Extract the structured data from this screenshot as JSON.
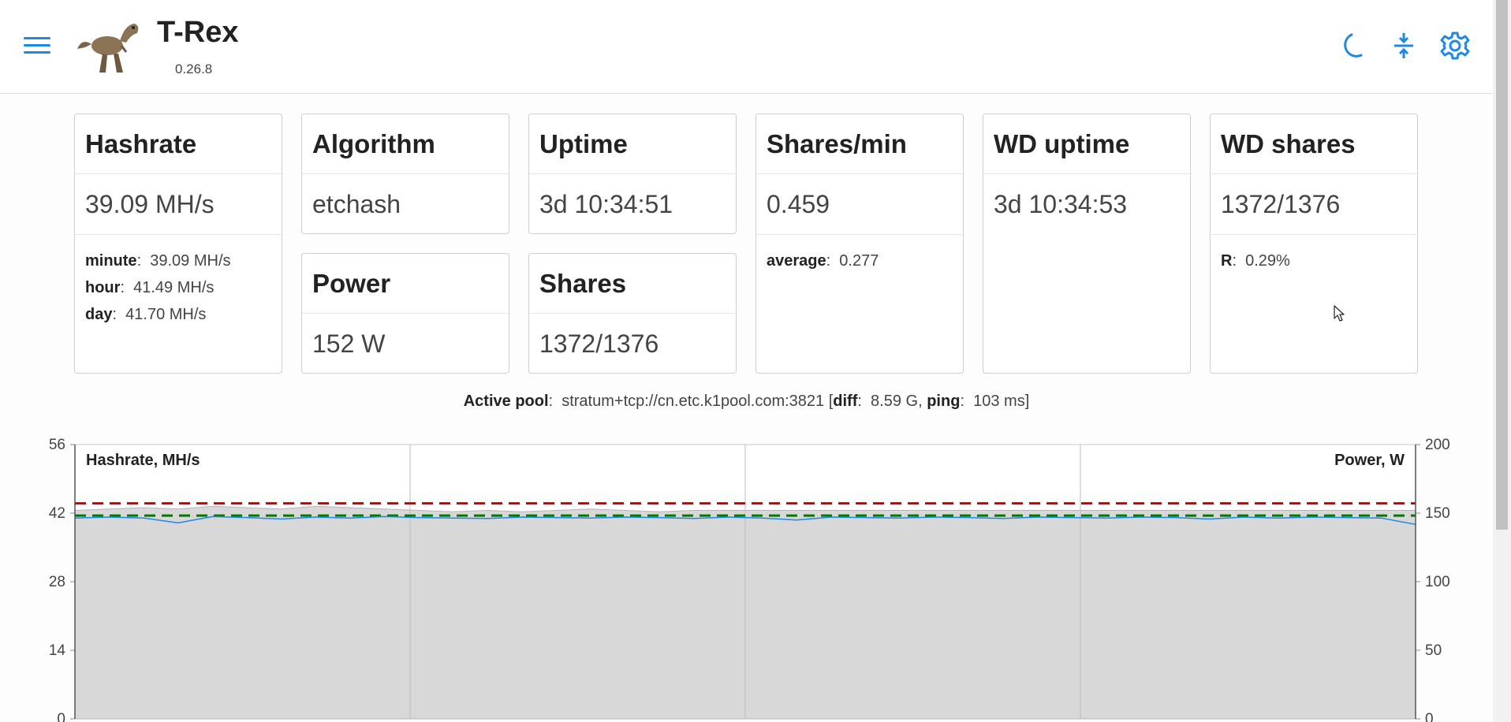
{
  "header": {
    "title": "T-Rex",
    "version": "0.26.8",
    "icons": [
      "menu-icon",
      "dinosaur-logo",
      "moon-icon",
      "compress-icon",
      "gear-icon"
    ],
    "accent": "#1e88e5"
  },
  "cards": {
    "hashrate": {
      "title": "Hashrate",
      "value": "39.09 MH/s",
      "minute_label": "minute",
      "minute_value": "39.09 MH/s",
      "hour_label": "hour",
      "hour_value": "41.49 MH/s",
      "day_label": "day",
      "day_value": "41.70 MH/s"
    },
    "algorithm": {
      "title": "Algorithm",
      "value": "etchash"
    },
    "power": {
      "title": "Power",
      "value": "152 W"
    },
    "uptime": {
      "title": "Uptime",
      "value": "3d 10:34:51"
    },
    "shares": {
      "title": "Shares",
      "value": "1372/1376"
    },
    "shares_min": {
      "title": "Shares/min",
      "value": "0.459",
      "average_label": "average",
      "average_value": "0.277"
    },
    "wd_uptime": {
      "title": "WD uptime",
      "value": "3d 10:34:53"
    },
    "wd_shares": {
      "title": "WD shares",
      "value": "1372/1376",
      "r_label": "R",
      "r_value": "0.29%"
    }
  },
  "pool": {
    "label": "Active pool",
    "url": "stratum+tcp://cn.etc.k1pool.com:3821",
    "diff_label": "diff",
    "diff_value": "8.59 G",
    "ping_label": "ping",
    "ping_value": "103 ms"
  },
  "chart_data": {
    "type": "area",
    "left_axis_label": "Hashrate, MH/s",
    "right_axis_label": "Power, W",
    "y_left_ticks": [
      "56",
      "42",
      "28",
      "14",
      "0"
    ],
    "y_right_ticks": [
      "200",
      "150",
      "100",
      "50",
      "0"
    ],
    "ylim_left": [
      0,
      56
    ],
    "ylim_right": [
      0,
      200
    ],
    "grid": true,
    "series": [
      {
        "values": [
          41.0,
          41.2,
          41.0,
          40.0,
          41.3,
          41.1,
          40.8,
          41.2,
          41.0,
          41.3,
          41.1,
          41.0,
          40.9,
          41.2,
          41.1,
          41.0,
          41.2,
          41.1,
          40.9,
          41.2,
          41.0,
          40.6,
          41.2,
          41.1,
          41.0,
          41.2,
          41.1,
          40.9,
          41.2,
          41.1,
          41.0,
          41.2,
          41.1,
          40.8,
          41.2,
          41.0,
          41.2,
          41.1,
          41.0,
          39.7
        ]
      },
      {
        "values": [
          152,
          153,
          154,
          153,
          155,
          154,
          153,
          155,
          154,
          153,
          152,
          151,
          152,
          151,
          152,
          153,
          152,
          151,
          152,
          152,
          152,
          152,
          152,
          152,
          152,
          152,
          152,
          152,
          152,
          152,
          152,
          152,
          152,
          152,
          152,
          152,
          152,
          152,
          152,
          152
        ]
      }
    ],
    "reference_lines": [
      {
        "value": 44.0,
        "color": "#cc0000"
      },
      {
        "value": 41.5,
        "color": "#007a00"
      }
    ],
    "colors": {
      "hashrate": "#1e88e5",
      "power_fill": "#d8d8d8",
      "power_line": "#b5b5b5"
    }
  }
}
